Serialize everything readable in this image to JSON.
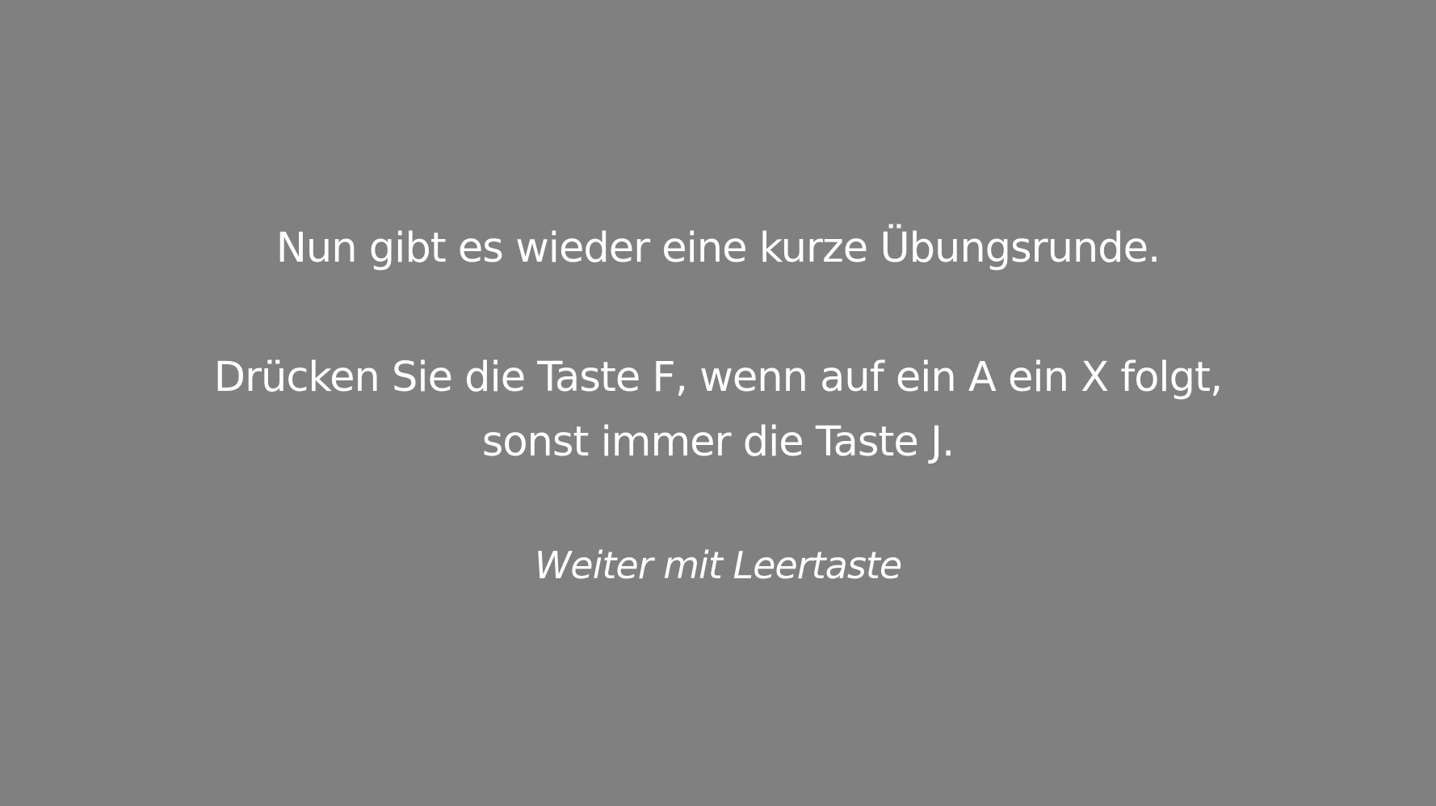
{
  "instructions": {
    "line1": "Nun gibt es wieder eine kurze Übungsrunde.",
    "line2": "Drücken Sie die Taste F, wenn auf ein A ein X folgt,",
    "line3": "sonst immer die Taste J."
  },
  "continue_hint": "Weiter mit Leertaste",
  "colors": {
    "background": "#808080",
    "text": "#ffffff"
  }
}
